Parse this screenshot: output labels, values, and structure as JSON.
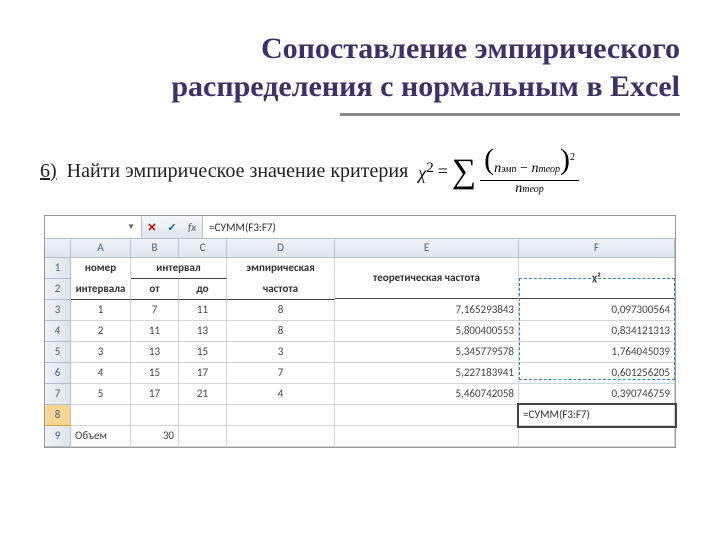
{
  "title_line1": "Сопоставление эмпирического",
  "title_line2": "распределения с нормальным в Excel",
  "step_num": "6)",
  "step_text": "Найти эмпирическое значение критерия",
  "formula": {
    "lhs": "χ",
    "sq": "2",
    "eq": "=",
    "num_left": "n",
    "num_left_sub": "эмп",
    "minus": "−",
    "num_right": "n",
    "num_right_sub": "теор",
    "den": "n",
    "den_sub": "теор"
  },
  "fx": {
    "name_box": "",
    "cancel": "✕",
    "enter": "✓",
    "fx": "fx",
    "formula": "=СУММ(F3:F7)"
  },
  "cols": [
    "",
    "A",
    "B",
    "C",
    "D",
    "E",
    "F"
  ],
  "head": {
    "r1": {
      "A": "номер",
      "B": "интервал",
      "D": "эмпирическая",
      "E": "теоретическая частота",
      "F": "χ²"
    },
    "r2": {
      "A": "интервала",
      "B": "от",
      "C": "до",
      "D": "частота"
    }
  },
  "rows": [
    {
      "n": "3",
      "A": "1",
      "B": "7",
      "C": "11",
      "D": "8",
      "E": "7,165293843",
      "F": "0,097300564"
    },
    {
      "n": "4",
      "A": "2",
      "B": "11",
      "C": "13",
      "D": "8",
      "E": "5,800400553",
      "F": "0,834121313"
    },
    {
      "n": "5",
      "A": "3",
      "B": "13",
      "C": "15",
      "D": "3",
      "E": "5,345779578",
      "F": "1,764045039"
    },
    {
      "n": "6",
      "A": "4",
      "B": "15",
      "C": "17",
      "D": "7",
      "E": "5,227183941",
      "F": "0,601256205"
    },
    {
      "n": "7",
      "A": "5",
      "B": "17",
      "C": "21",
      "D": "4",
      "E": "5,460742058",
      "F": "0,390746759"
    }
  ],
  "row8": {
    "n": "8",
    "editing": "=СУММ(F3:F7)"
  },
  "row9": {
    "n": "9",
    "A": "Объем",
    "B": "30"
  }
}
